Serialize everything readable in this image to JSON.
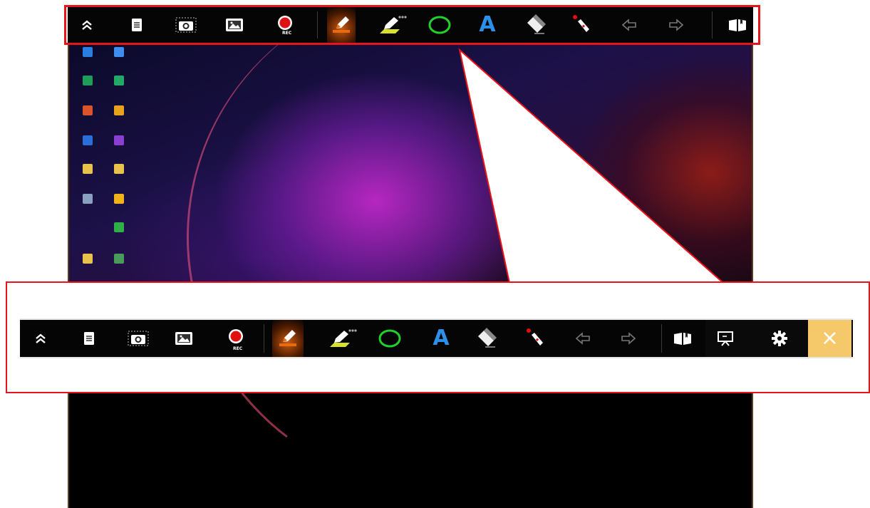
{
  "toolbar": {
    "rec_label": "REC",
    "text_tool_glyph": "A",
    "tools": [
      {
        "name": "collapse",
        "icon": "double-chevron-up-icon"
      },
      {
        "name": "whiteboard",
        "icon": "notepad-icon"
      },
      {
        "name": "screenshot",
        "icon": "camera-icon"
      },
      {
        "name": "image",
        "icon": "picture-icon"
      },
      {
        "name": "record",
        "icon": "record-icon"
      },
      {
        "name": "pen",
        "icon": "pen-icon"
      },
      {
        "name": "highlighter",
        "icon": "highlighter-icon"
      },
      {
        "name": "shape",
        "icon": "circle-icon"
      },
      {
        "name": "text",
        "icon": "text-icon"
      },
      {
        "name": "eraser",
        "icon": "eraser-icon"
      },
      {
        "name": "laser-pointer",
        "icon": "laser-pointer-icon"
      },
      {
        "name": "undo",
        "icon": "undo-icon"
      },
      {
        "name": "redo",
        "icon": "redo-icon"
      },
      {
        "name": "book",
        "icon": "book-icon"
      },
      {
        "name": "presentation",
        "icon": "presentation-icon"
      },
      {
        "name": "settings",
        "icon": "gear-icon"
      },
      {
        "name": "close",
        "icon": "close-icon"
      }
    ],
    "colors": {
      "background": "#050505",
      "record_red": "#e01010",
      "pen_active_orange": "#e86a12",
      "shape_green": "#1fd12a",
      "text_blue": "#2c8fe8",
      "close_bg": "#f5c96a",
      "highlight_red": "#e8141c"
    }
  },
  "close_glyph": "×"
}
